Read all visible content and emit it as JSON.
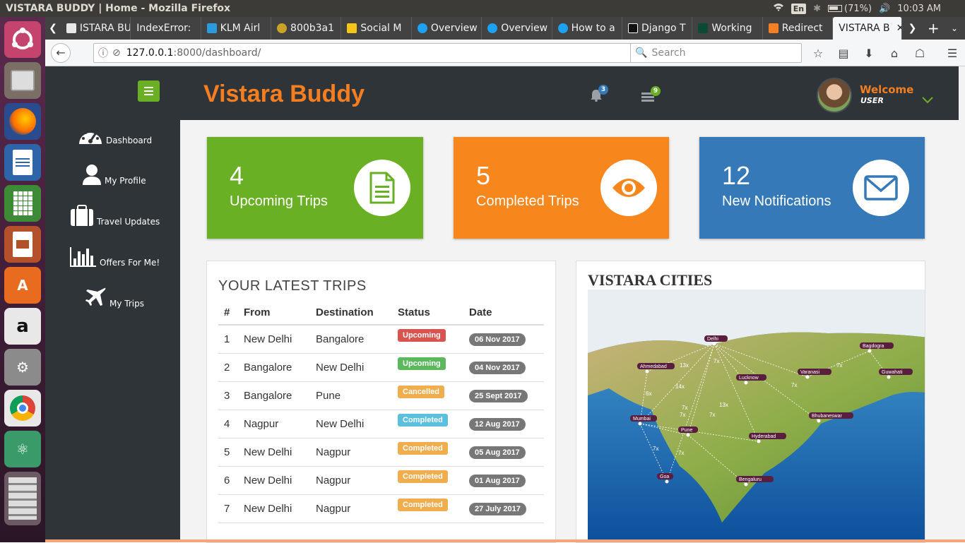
{
  "system": {
    "window_title": "VISTARA BUDDY | Home - Mozilla Firefox",
    "keyboard_layout": "En",
    "battery": "(71%)",
    "clock": "10:03 AM"
  },
  "tabs": [
    {
      "label": "ISTARA BU",
      "color": "#e8e8e8"
    },
    {
      "label": "IndexError: ",
      "color": "#5a5a5a"
    },
    {
      "label": "KLM Airl",
      "color": "#2b9be0"
    },
    {
      "label": "800b3a1",
      "color": "#c9a227"
    },
    {
      "label": "Social M",
      "color": "#f5c518"
    },
    {
      "label": "Overview",
      "color": "#1da1f2"
    },
    {
      "label": "Overview",
      "color": "#1da1f2"
    },
    {
      "label": "How to a",
      "color": "#1da1f2"
    },
    {
      "label": "Django T",
      "color": "#111111"
    },
    {
      "label": "Working",
      "color": "#0c4b33"
    },
    {
      "label": "Redirect",
      "color": "#f48024"
    }
  ],
  "active_tab": {
    "label": "VISTARA B"
  },
  "browser": {
    "url_host": "127.0.0.1",
    "url_path": ":8000/dashboard/",
    "search_placeholder": "Search"
  },
  "sidebar": {
    "items": [
      {
        "label": "Dashboard",
        "icon": "dashboard-icon"
      },
      {
        "label": "My Profile",
        "icon": "user-icon"
      },
      {
        "label": "Travel Updates",
        "icon": "suitcase-icon"
      },
      {
        "label": "Offers For Me!",
        "icon": "bar-chart-icon"
      },
      {
        "label": "My Trips",
        "icon": "plane-icon"
      }
    ]
  },
  "header": {
    "brand": "Vistara Buddy",
    "notification_count": "3",
    "message_count": "9",
    "welcome": "Welcome",
    "user": "USER"
  },
  "stats": [
    {
      "value": "4",
      "label": "Upcoming Trips",
      "color": "#6ab024",
      "icon": "document-icon"
    },
    {
      "value": "5",
      "label": "Completed Trips",
      "color": "#f7861c",
      "icon": "eye-icon"
    },
    {
      "value": "12",
      "label": "New Notifications",
      "color": "#3579b9",
      "icon": "envelope-icon"
    }
  ],
  "trips": {
    "title": "YOUR LATEST TRIPS",
    "headers": [
      "#",
      "From",
      "Destination",
      "Status",
      "Date"
    ],
    "rows": [
      {
        "n": "1",
        "from": "New Delhi",
        "to": "Bangalore",
        "status": "Upcoming",
        "status_color": "#d9534f",
        "date": "06 Nov 2017"
      },
      {
        "n": "2",
        "from": "Bangalore",
        "to": "New Delhi",
        "status": "Upcoming",
        "status_color": "#5cb85c",
        "date": "04 Nov 2017"
      },
      {
        "n": "3",
        "from": "Bangalore",
        "to": "Pune",
        "status": "Cancelled",
        "status_color": "#f0ad4e",
        "date": "25 Sept 2017"
      },
      {
        "n": "4",
        "from": "Nagpur",
        "to": "New Delhi",
        "status": "Completed",
        "status_color": "#5bc0de",
        "date": "12 Aug 2017"
      },
      {
        "n": "5",
        "from": "New Delhi",
        "to": "Nagpur",
        "status": "Completed",
        "status_color": "#f0ad4e",
        "date": "05 Aug 2017"
      },
      {
        "n": "6",
        "from": "New Delhi",
        "to": "Nagpur",
        "status": "Completed",
        "status_color": "#f0ad4e",
        "date": "01 Aug 2017"
      },
      {
        "n": "7",
        "from": "New Delhi",
        "to": "Nagpur",
        "status": "Completed",
        "status_color": "#f0ad4e",
        "date": "27 July 2017"
      }
    ]
  },
  "cities": {
    "title": "VISTARA CITIES",
    "labels": [
      "Delhi",
      "Ahmedabad",
      "Lucknow",
      "Varanasi",
      "Bagdogra",
      "Guwahati",
      "Mumbai",
      "Pune",
      "Bhubaneswar",
      "Hyderabad",
      "Goa",
      "Bengaluru"
    ],
    "frequencies": [
      "13x",
      "6x",
      "7x",
      "14x",
      "7x",
      "7x",
      "7x",
      "7x",
      "13x",
      "7x",
      "7x",
      "7x"
    ]
  }
}
